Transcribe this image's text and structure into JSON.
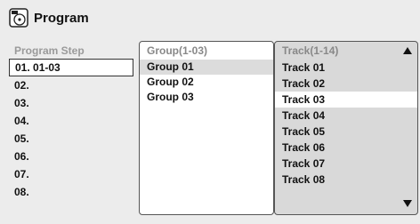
{
  "title": "Program",
  "columns": {
    "step_header": "Program Step",
    "group_header": "Group(1-03)",
    "track_header": "Track(1-14)"
  },
  "steps": [
    "01. 01-03",
    "02.",
    "03.",
    "04.",
    "05.",
    "06.",
    "07.",
    "08."
  ],
  "groups": [
    "Group 01",
    "Group 02",
    "Group 03"
  ],
  "tracks": [
    "Track 01",
    "Track 02",
    "Track 03",
    "Track 04",
    "Track 05",
    "Track 06",
    "Track 07",
    "Track 08"
  ],
  "selected_step_index": 0,
  "selected_group_index": 0,
  "selected_track_index": 2,
  "icons": {
    "title": "disc-program-icon",
    "up": "scroll-up-arrow-icon",
    "down": "scroll-down-arrow-icon"
  }
}
